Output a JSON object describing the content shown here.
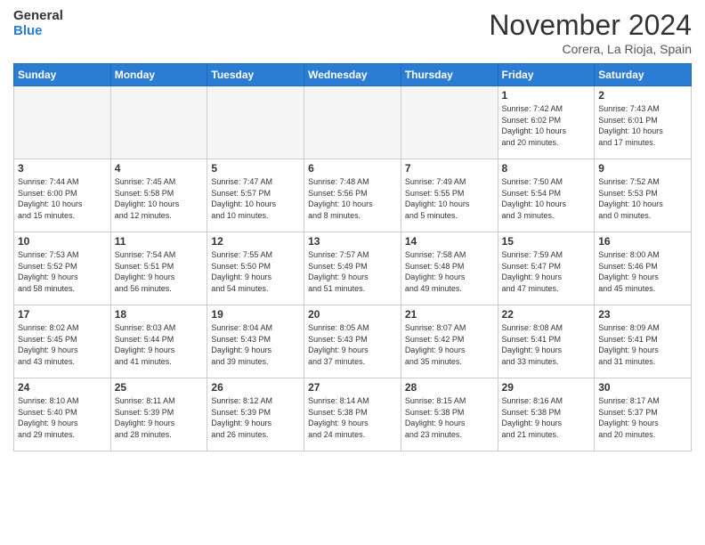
{
  "header": {
    "logo_line1": "General",
    "logo_line2": "Blue",
    "month_title": "November 2024",
    "location": "Corera, La Rioja, Spain"
  },
  "weekdays": [
    "Sunday",
    "Monday",
    "Tuesday",
    "Wednesday",
    "Thursday",
    "Friday",
    "Saturday"
  ],
  "weeks": [
    [
      {
        "day": "",
        "info": ""
      },
      {
        "day": "",
        "info": ""
      },
      {
        "day": "",
        "info": ""
      },
      {
        "day": "",
        "info": ""
      },
      {
        "day": "",
        "info": ""
      },
      {
        "day": "1",
        "info": "Sunrise: 7:42 AM\nSunset: 6:02 PM\nDaylight: 10 hours\nand 20 minutes."
      },
      {
        "day": "2",
        "info": "Sunrise: 7:43 AM\nSunset: 6:01 PM\nDaylight: 10 hours\nand 17 minutes."
      }
    ],
    [
      {
        "day": "3",
        "info": "Sunrise: 7:44 AM\nSunset: 6:00 PM\nDaylight: 10 hours\nand 15 minutes."
      },
      {
        "day": "4",
        "info": "Sunrise: 7:45 AM\nSunset: 5:58 PM\nDaylight: 10 hours\nand 12 minutes."
      },
      {
        "day": "5",
        "info": "Sunrise: 7:47 AM\nSunset: 5:57 PM\nDaylight: 10 hours\nand 10 minutes."
      },
      {
        "day": "6",
        "info": "Sunrise: 7:48 AM\nSunset: 5:56 PM\nDaylight: 10 hours\nand 8 minutes."
      },
      {
        "day": "7",
        "info": "Sunrise: 7:49 AM\nSunset: 5:55 PM\nDaylight: 10 hours\nand 5 minutes."
      },
      {
        "day": "8",
        "info": "Sunrise: 7:50 AM\nSunset: 5:54 PM\nDaylight: 10 hours\nand 3 minutes."
      },
      {
        "day": "9",
        "info": "Sunrise: 7:52 AM\nSunset: 5:53 PM\nDaylight: 10 hours\nand 0 minutes."
      }
    ],
    [
      {
        "day": "10",
        "info": "Sunrise: 7:53 AM\nSunset: 5:52 PM\nDaylight: 9 hours\nand 58 minutes."
      },
      {
        "day": "11",
        "info": "Sunrise: 7:54 AM\nSunset: 5:51 PM\nDaylight: 9 hours\nand 56 minutes."
      },
      {
        "day": "12",
        "info": "Sunrise: 7:55 AM\nSunset: 5:50 PM\nDaylight: 9 hours\nand 54 minutes."
      },
      {
        "day": "13",
        "info": "Sunrise: 7:57 AM\nSunset: 5:49 PM\nDaylight: 9 hours\nand 51 minutes."
      },
      {
        "day": "14",
        "info": "Sunrise: 7:58 AM\nSunset: 5:48 PM\nDaylight: 9 hours\nand 49 minutes."
      },
      {
        "day": "15",
        "info": "Sunrise: 7:59 AM\nSunset: 5:47 PM\nDaylight: 9 hours\nand 47 minutes."
      },
      {
        "day": "16",
        "info": "Sunrise: 8:00 AM\nSunset: 5:46 PM\nDaylight: 9 hours\nand 45 minutes."
      }
    ],
    [
      {
        "day": "17",
        "info": "Sunrise: 8:02 AM\nSunset: 5:45 PM\nDaylight: 9 hours\nand 43 minutes."
      },
      {
        "day": "18",
        "info": "Sunrise: 8:03 AM\nSunset: 5:44 PM\nDaylight: 9 hours\nand 41 minutes."
      },
      {
        "day": "19",
        "info": "Sunrise: 8:04 AM\nSunset: 5:43 PM\nDaylight: 9 hours\nand 39 minutes."
      },
      {
        "day": "20",
        "info": "Sunrise: 8:05 AM\nSunset: 5:43 PM\nDaylight: 9 hours\nand 37 minutes."
      },
      {
        "day": "21",
        "info": "Sunrise: 8:07 AM\nSunset: 5:42 PM\nDaylight: 9 hours\nand 35 minutes."
      },
      {
        "day": "22",
        "info": "Sunrise: 8:08 AM\nSunset: 5:41 PM\nDaylight: 9 hours\nand 33 minutes."
      },
      {
        "day": "23",
        "info": "Sunrise: 8:09 AM\nSunset: 5:41 PM\nDaylight: 9 hours\nand 31 minutes."
      }
    ],
    [
      {
        "day": "24",
        "info": "Sunrise: 8:10 AM\nSunset: 5:40 PM\nDaylight: 9 hours\nand 29 minutes."
      },
      {
        "day": "25",
        "info": "Sunrise: 8:11 AM\nSunset: 5:39 PM\nDaylight: 9 hours\nand 28 minutes."
      },
      {
        "day": "26",
        "info": "Sunrise: 8:12 AM\nSunset: 5:39 PM\nDaylight: 9 hours\nand 26 minutes."
      },
      {
        "day": "27",
        "info": "Sunrise: 8:14 AM\nSunset: 5:38 PM\nDaylight: 9 hours\nand 24 minutes."
      },
      {
        "day": "28",
        "info": "Sunrise: 8:15 AM\nSunset: 5:38 PM\nDaylight: 9 hours\nand 23 minutes."
      },
      {
        "day": "29",
        "info": "Sunrise: 8:16 AM\nSunset: 5:38 PM\nDaylight: 9 hours\nand 21 minutes."
      },
      {
        "day": "30",
        "info": "Sunrise: 8:17 AM\nSunset: 5:37 PM\nDaylight: 9 hours\nand 20 minutes."
      }
    ]
  ]
}
